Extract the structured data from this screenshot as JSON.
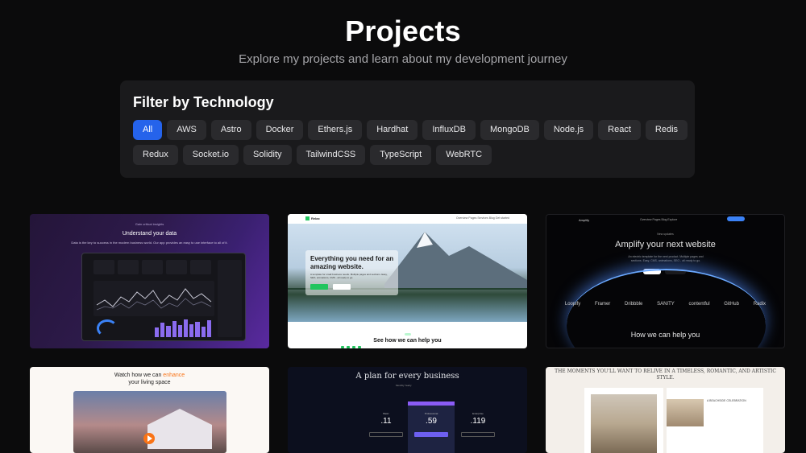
{
  "header": {
    "title": "Projects",
    "subtitle": "Explore my projects and learn about my development journey"
  },
  "filter": {
    "title": "Filter by Technology",
    "active": "All",
    "row1": [
      "All",
      "AWS",
      "Astro",
      "Docker",
      "Ethers.js",
      "Hardhat",
      "InfluxDB",
      "MongoDB",
      "Node.js",
      "React",
      "Redis"
    ],
    "row2": [
      "Redux",
      "Socket.io",
      "Solidity",
      "TailwindCSS",
      "TypeScript",
      "WebRTC"
    ]
  },
  "projects": {
    "card1": {
      "tag": "Gain critical insights",
      "heading": "Understand your data",
      "text": "Data is the key to success in the modern business world. Our app provides an easy to use interface to all of it.",
      "bars": [
        0.55,
        0.8,
        0.65,
        0.9,
        0.7,
        1.0,
        0.75,
        0.85,
        0.6,
        0.95
      ],
      "accent": "#8b6cf0"
    },
    "card2": {
      "brand": "Relax",
      "nav": "Overview   Pages   Services   Blog   Get started",
      "heading": "Everything you need for an amazing website.",
      "text": "A template for small business needs. Multiple pages and sections. Easy, SEO, animations, CMS - all ready to go.",
      "footer": "See how we can help you",
      "accent": "#22c55e"
    },
    "card3": {
      "brand": "Amplify",
      "nav": "Overview   Pages   Blog   Explore",
      "tag": "New updates",
      "heading": "Amplify your next website",
      "text": "An electric template for the next product. Multiple pages and sections. Easy, CMS, animations, SEO - all ready to go.",
      "brands": [
        "Loopify",
        "Framer",
        "Dribbble",
        "SANITY",
        "contentful",
        "GitHub",
        "Radix"
      ],
      "help": "How we can help you",
      "accent": "#3b82f6"
    },
    "card4": {
      "heading_pre": "Watch how we can",
      "heading_accent": "enhance",
      "heading_post": "your living space",
      "accent": "#f97316"
    },
    "card5": {
      "heading": "A plan for every business",
      "toggle": "Monthly   Yearly",
      "plans": [
        {
          "name": "Basic",
          "price": ".11"
        },
        {
          "name": "Professional",
          "price": ".59"
        },
        {
          "name": "Enterprise",
          "price": ".119"
        }
      ],
      "accent": "#8b5cf6"
    },
    "card6": {
      "heading": "THE MOMENTS YOU'LL WANT TO RELIVE IN A TIMELESS, ROMANTIC, AND ARTISTIC STYLE.",
      "caption": "A BEACHSIDE CELEBRATION"
    }
  }
}
